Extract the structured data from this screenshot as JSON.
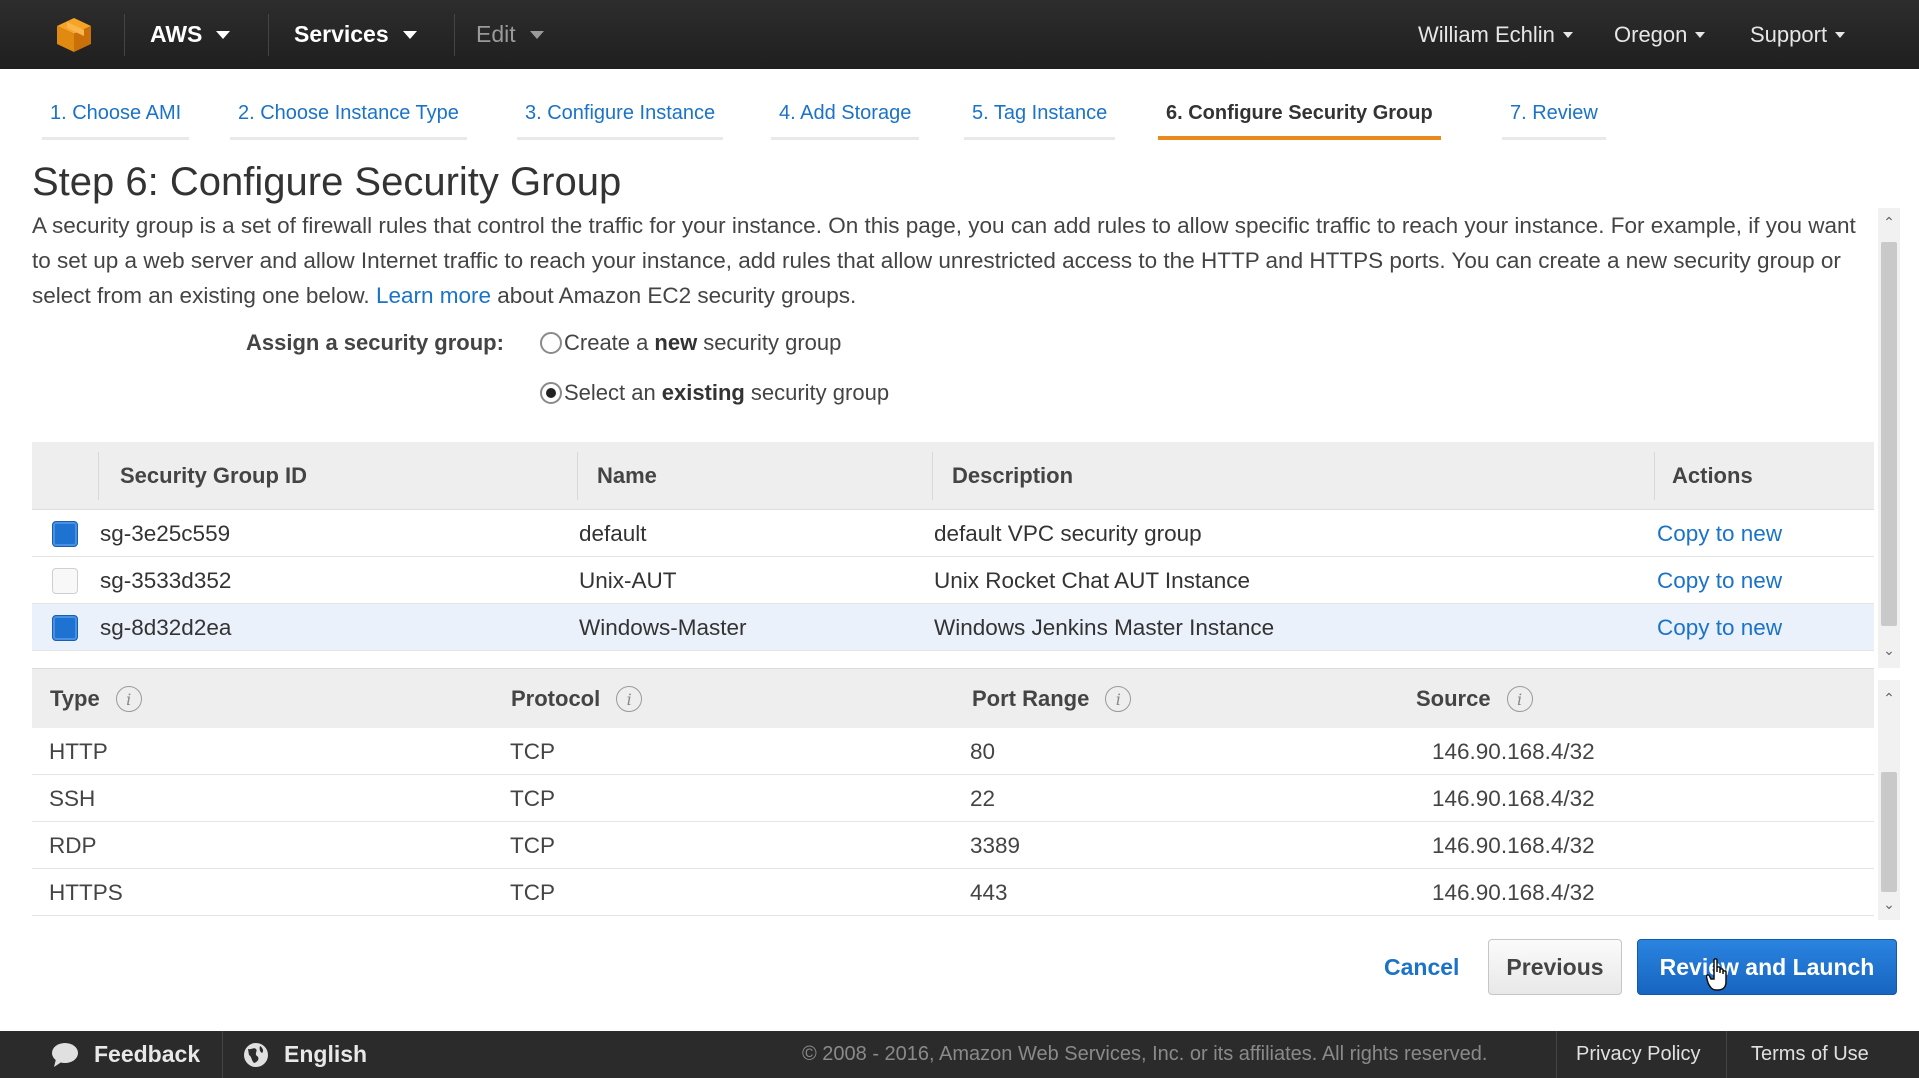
{
  "topbar": {
    "aws_label": "AWS",
    "services_label": "Services",
    "edit_label": "Edit",
    "user_label": "William Echlin",
    "region_label": "Oregon",
    "support_label": "Support"
  },
  "steps": [
    {
      "label": "1. Choose AMI"
    },
    {
      "label": "2. Choose Instance Type"
    },
    {
      "label": "3. Configure Instance"
    },
    {
      "label": "4. Add Storage"
    },
    {
      "label": "5. Tag Instance"
    },
    {
      "label": "6. Configure Security Group"
    },
    {
      "label": "7. Review"
    }
  ],
  "page": {
    "title": "Step 6: Configure Security Group",
    "intro_text": "A security group is a set of firewall rules that control the traffic for your instance. On this page, you can add rules to allow specific traffic to reach your instance. For example, if you want to set up a web server and allow Internet traffic to reach your instance, add rules that allow unrestricted access to the HTTP and HTTPS ports. You can create a new security group or select from an existing one below.",
    "learn_more": "Learn more",
    "intro_suffix": "about Amazon EC2 security groups."
  },
  "assign": {
    "label": "Assign a security group:",
    "option_new_prefix": "Create a",
    "option_new_bold": "new",
    "option_new_suffix": "security group",
    "option_existing_prefix": "Select an",
    "option_existing_bold": "existing",
    "option_existing_suffix": "security group",
    "selected": "existing"
  },
  "sg_table": {
    "headers": {
      "id": "Security Group ID",
      "name": "Name",
      "description": "Description",
      "actions": "Actions"
    },
    "rows": [
      {
        "checked": true,
        "id": "sg-3e25c559",
        "name": "default",
        "description": "default VPC security group",
        "action": "Copy to new"
      },
      {
        "checked": false,
        "id": "sg-3533d352",
        "name": "Unix-AUT",
        "description": "Unix Rocket Chat AUT Instance",
        "action": "Copy to new"
      },
      {
        "checked": true,
        "id": "sg-8d32d2ea",
        "name": "Windows-Master",
        "description": "Windows Jenkins Master Instance",
        "action": "Copy to new"
      }
    ]
  },
  "rules_table": {
    "headers": {
      "type": "Type",
      "protocol": "Protocol",
      "port_range": "Port Range",
      "source": "Source"
    },
    "rows": [
      {
        "type": "HTTP",
        "protocol": "TCP",
        "port": "80",
        "source": "146.90.168.4/32"
      },
      {
        "type": "SSH",
        "protocol": "TCP",
        "port": "22",
        "source": "146.90.168.4/32"
      },
      {
        "type": "RDP",
        "protocol": "TCP",
        "port": "3389",
        "source": "146.90.168.4/32"
      },
      {
        "type": "HTTPS",
        "protocol": "TCP",
        "port": "443",
        "source": "146.90.168.4/32"
      }
    ]
  },
  "actions": {
    "cancel": "Cancel",
    "previous": "Previous",
    "review_launch": "Review and Launch"
  },
  "footer": {
    "feedback": "Feedback",
    "language": "English",
    "copyright": "© 2008 - 2016, Amazon Web Services, Inc. or its affiliates. All rights reserved.",
    "privacy": "Privacy Policy",
    "terms": "Terms of Use"
  },
  "colors": {
    "link": "#1a73c8",
    "active_step_underline": "#e88a1d",
    "primary_button": "#1e73d2",
    "topbar_bg": "#262626"
  }
}
